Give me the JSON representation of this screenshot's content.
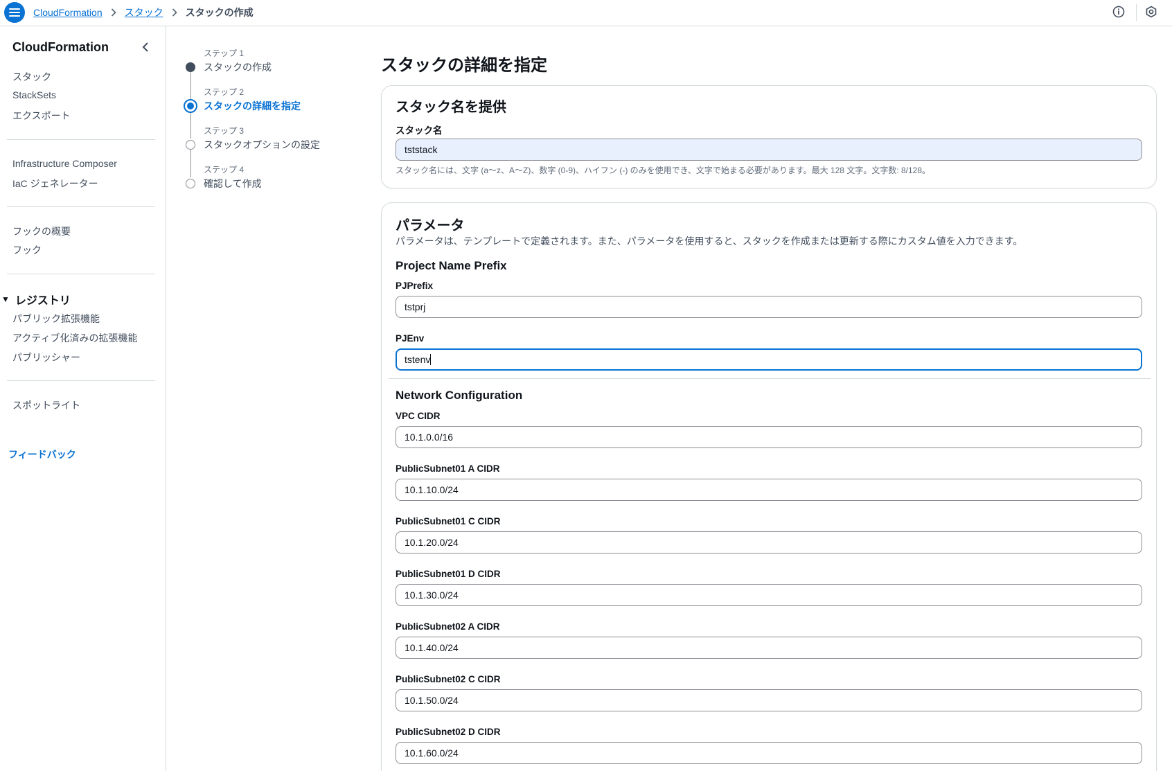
{
  "header": {
    "breadcrumbs": [
      "CloudFormation",
      "スタック",
      "スタックの作成"
    ],
    "menu_icon": "hamburger-menu-icon",
    "info_icon": "info-icon",
    "settings_icon": "hexagon-gear-icon"
  },
  "sidebar": {
    "title": "CloudFormation",
    "group1": [
      "スタック",
      "StackSets",
      "エクスポート"
    ],
    "group2": [
      "Infrastructure Composer",
      "IaC ジェネレーター"
    ],
    "group3": [
      "フックの概要",
      "フック"
    ],
    "registry": {
      "title": "レジストリ",
      "items": [
        "パブリック拡張機能",
        "アクティブ化済みの拡張機能",
        "パブリッシャー"
      ]
    },
    "group5": [
      "スポットライト"
    ],
    "feedback": "フィードバック"
  },
  "steps": [
    {
      "label": "ステップ 1",
      "title": "スタックの作成",
      "state": "completed"
    },
    {
      "label": "ステップ 2",
      "title": "スタックの詳細を指定",
      "state": "active"
    },
    {
      "label": "ステップ 3",
      "title": "スタックオプションの設定",
      "state": "pending"
    },
    {
      "label": "ステップ 4",
      "title": "確認して作成",
      "state": "pending"
    }
  ],
  "main": {
    "title": "スタックの詳細を指定",
    "stack_name_card": {
      "title": "スタック名を提供",
      "label": "スタック名",
      "value": "tststack",
      "hint": "スタック名には、文字 (a〜z、A〜Z)、数字 (0-9)、ハイフン (-) のみを使用でき、文字で始まる必要があります。最大 128 文字。文字数:  8/128。"
    },
    "parameters_card": {
      "title": "パラメータ",
      "description": "パラメータは、テンプレートで定義されます。また、パラメータを使用すると、スタックを作成または更新する際にカスタム値を入力できます。",
      "project_section": {
        "heading": "Project Name Prefix",
        "fields": [
          {
            "label": "PJPrefix",
            "value": "tstprj"
          },
          {
            "label": "PJEnv",
            "value": "tstenv"
          }
        ]
      },
      "network_section": {
        "heading": "Network Configuration",
        "fields": [
          {
            "label": "VPC CIDR",
            "value": "10.1.0.0/16"
          },
          {
            "label": "PublicSubnet01 A CIDR",
            "value": "10.1.10.0/24"
          },
          {
            "label": "PublicSubnet01 C CIDR",
            "value": "10.1.20.0/24"
          },
          {
            "label": "PublicSubnet01 D CIDR",
            "value": "10.1.30.0/24"
          },
          {
            "label": "PublicSubnet02 A CIDR",
            "value": "10.1.40.0/24"
          },
          {
            "label": "PublicSubnet02 C CIDR",
            "value": "10.1.50.0/24"
          },
          {
            "label": "PublicSubnet02 D CIDR",
            "value": "10.1.60.0/24"
          }
        ]
      }
    }
  },
  "colors": {
    "accent": "#0972d3",
    "text": "#0f141a",
    "muted": "#5f6b7a",
    "border": "#d5dbdb"
  }
}
